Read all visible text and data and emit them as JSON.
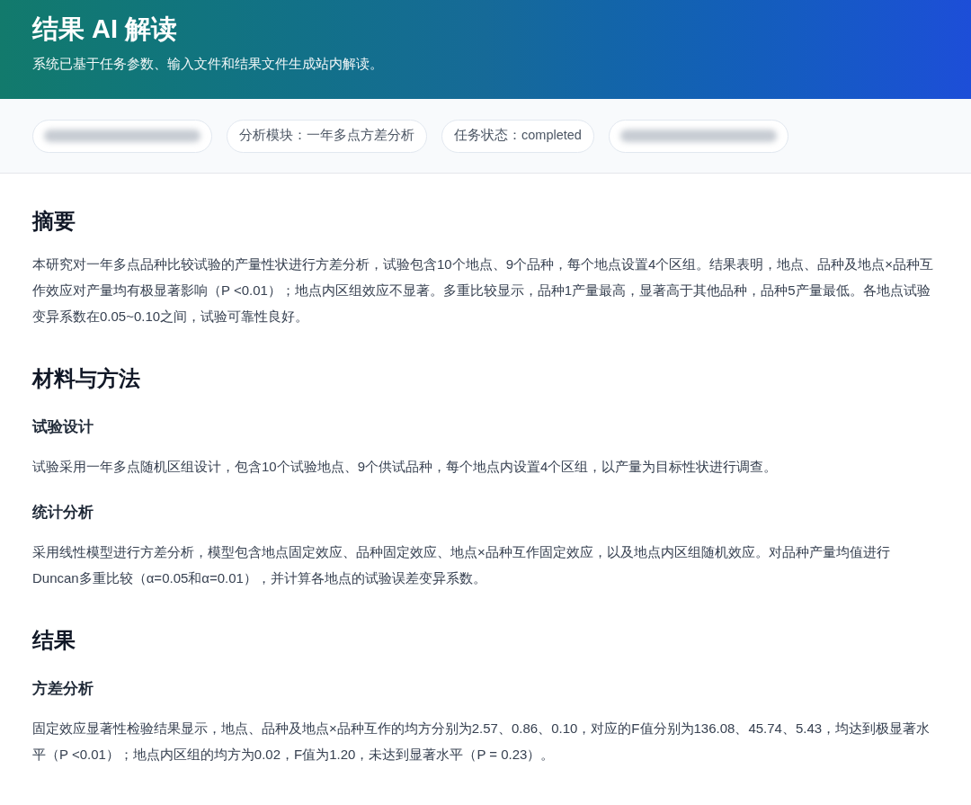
{
  "header": {
    "title": "结果 AI 解读",
    "subtitle": "系统已基于任务参数、输入文件和结果文件生成站内解读。"
  },
  "meta_pills": [
    {
      "kind": "redacted"
    },
    {
      "kind": "text",
      "label": "分析模块：一年多点方差分析"
    },
    {
      "kind": "text",
      "label": "任务状态：completed"
    },
    {
      "kind": "redacted"
    }
  ],
  "sections": [
    {
      "title": "摘要",
      "blocks": [
        {
          "kind": "paragraph",
          "text": "本研究对一年多点品种比较试验的产量性状进行方差分析，试验包含10个地点、9个品种，每个地点设置4个区组。结果表明，地点、品种及地点×品种互作效应对产量均有极显著影响（P <0.01）；地点内区组效应不显著。多重比较显示，品种1产量最高，显著高于其他品种，品种5产量最低。各地点试验变异系数在0.05~0.10之间，试验可靠性良好。"
        }
      ]
    },
    {
      "title": "材料与方法",
      "blocks": [
        {
          "kind": "subheading",
          "text": "试验设计"
        },
        {
          "kind": "paragraph",
          "text": "试验采用一年多点随机区组设计，包含10个试验地点、9个供试品种，每个地点内设置4个区组，以产量为目标性状进行调查。"
        },
        {
          "kind": "subheading",
          "text": "统计分析"
        },
        {
          "kind": "paragraph",
          "text": "采用线性模型进行方差分析，模型包含地点固定效应、品种固定效应、地点×品种互作固定效应，以及地点内区组随机效应。对品种产量均值进行Duncan多重比较（α=0.05和α=0.01），并计算各地点的试验误差变异系数。"
        }
      ]
    },
    {
      "title": "结果",
      "blocks": [
        {
          "kind": "subheading",
          "text": "方差分析"
        },
        {
          "kind": "paragraph",
          "text": "固定效应显著性检验结果显示，地点、品种及地点×品种互作的均方分别为2.57、0.86、0.10，对应的F值分别为136.08、45.74、5.43，均达到极显著水平（P <0.01）；地点内区组的均方为0.02，F值为1.20，未达到显著水平（P = 0.23）。"
        }
      ]
    }
  ]
}
